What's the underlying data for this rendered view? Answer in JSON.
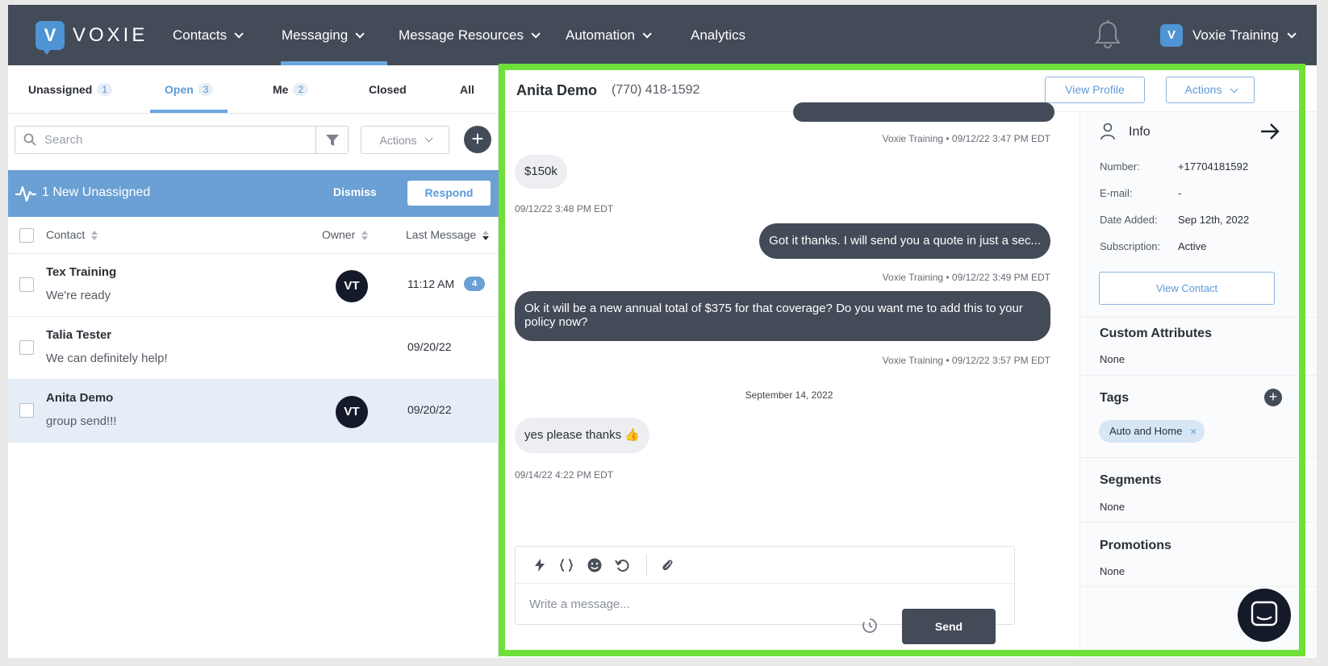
{
  "nav": {
    "logo_text": "VOXIE",
    "logo_mark": "V",
    "items": [
      {
        "label": "Contacts"
      },
      {
        "label": "Messaging"
      },
      {
        "label": "Message Resources"
      },
      {
        "label": "Automation"
      },
      {
        "label": "Analytics"
      }
    ],
    "account_label": "Voxie Training",
    "account_mark": "V"
  },
  "inbox": {
    "tabs": [
      {
        "label": "Unassigned",
        "count": "1"
      },
      {
        "label": "Open",
        "count": "3"
      },
      {
        "label": "Me",
        "count": "2"
      },
      {
        "label": "Closed"
      },
      {
        "label": "All"
      }
    ],
    "search_placeholder": "Search",
    "actions_label": "Actions",
    "plus_label": "+",
    "banner": {
      "text": "1 New Unassigned",
      "dismiss": "Dismiss",
      "respond": "Respond"
    },
    "columns": {
      "contact": "Contact",
      "owner": "Owner",
      "last_message": "Last Message"
    },
    "rows": [
      {
        "name": "Tex Training",
        "preview": "We're ready",
        "owner": "VT",
        "time": "11:12 AM",
        "unread": "4"
      },
      {
        "name": "Talia Tester",
        "preview": "We can definitely help!",
        "owner": "",
        "time": "09/20/22"
      },
      {
        "name": "Anita Demo",
        "preview": "group send!!!",
        "owner": "VT",
        "time": "09/20/22"
      }
    ]
  },
  "conversation": {
    "name": "Anita Demo",
    "phone": "(770) 418-1592",
    "view_profile": "View Profile",
    "actions": "Actions",
    "messages": [
      {
        "meta": "Voxie Training • 09/12/22 3:47 PM EDT"
      },
      {
        "text": "$150k",
        "meta": "09/12/22 3:48 PM EDT"
      },
      {
        "text": "Got it thanks. I will send you a quote in just a sec...",
        "meta": "Voxie Training • 09/12/22 3:49 PM EDT"
      },
      {
        "text": "Ok it will be a new annual total of $375 for that coverage? Do you want me to add this to your policy now?",
        "meta": "Voxie Training • 09/12/22 3:57 PM EDT"
      },
      {
        "text": "yes please thanks 👍",
        "meta": "09/14/22 4:22 PM EDT"
      }
    ],
    "day_separator": "September 14, 2022",
    "composer_placeholder": "Write a message...",
    "send_label": "Send"
  },
  "info": {
    "title": "Info",
    "fields": [
      {
        "label": "Number:",
        "value": "+17704181592"
      },
      {
        "label": "E-mail:",
        "value": "-"
      },
      {
        "label": "Date Added:",
        "value": "Sep 12th, 2022"
      },
      {
        "label": "Subscription:",
        "value": "Active"
      }
    ],
    "view_contact": "View Contact",
    "custom_attributes": {
      "title": "Custom Attributes",
      "value": "None"
    },
    "tags": {
      "title": "Tags",
      "items": [
        "Auto and Home"
      ],
      "remove": "×",
      "add": "+"
    },
    "segments": {
      "title": "Segments",
      "value": "None"
    },
    "promotions": {
      "title": "Promotions",
      "value": "None"
    }
  },
  "colors": {
    "nav_bg": "#434b58",
    "accent": "#6aa7dd",
    "highlight_border": "#6fe03a",
    "banner": "#6aa0d4"
  }
}
